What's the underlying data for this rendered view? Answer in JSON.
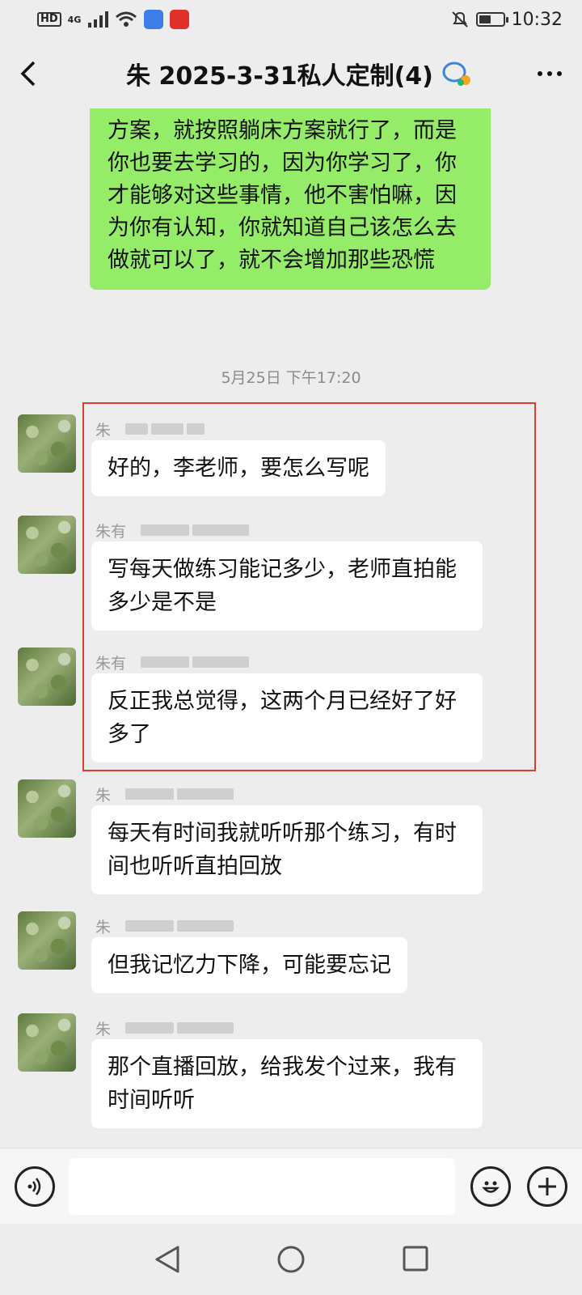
{
  "status_bar": {
    "hd": "HD",
    "network": "4G",
    "time": "10:32",
    "battery_level": 0.45
  },
  "header": {
    "title": "朱            2025-3-31私人定制(4)"
  },
  "outgoing_message": {
    "text": "方案，就按照躺床方案就行了，而是你也要去学习的，因为你学习了，你才能够对这些事情，他不害怕嘛，因为你有认知，你就知道自己该怎么去做就可以了，就不会增加那些恐慌"
  },
  "time_separator": "5月25日 下午17:20",
  "messages": [
    {
      "sender": "朱",
      "text": "好的，李老师，要怎么写呢"
    },
    {
      "sender": "朱有",
      "text": "写每天做练习能记多少，老师直拍能多少是不是"
    },
    {
      "sender": "朱有",
      "text": "反正我总觉得，这两个月已经好了好多了"
    },
    {
      "sender": "朱",
      "text": "每天有时间我就听听那个练习，有时间也听听直拍回放"
    },
    {
      "sender": "朱",
      "text": "但我记忆力下降，可能要忘记"
    },
    {
      "sender": "朱",
      "text": "那个直播回放，给我发个过来，我有时间听听"
    }
  ],
  "colors": {
    "outgoing_bubble": "#95ec69",
    "incoming_bubble": "#ffffff",
    "background": "#ededed",
    "highlight": "#e23b2e"
  }
}
